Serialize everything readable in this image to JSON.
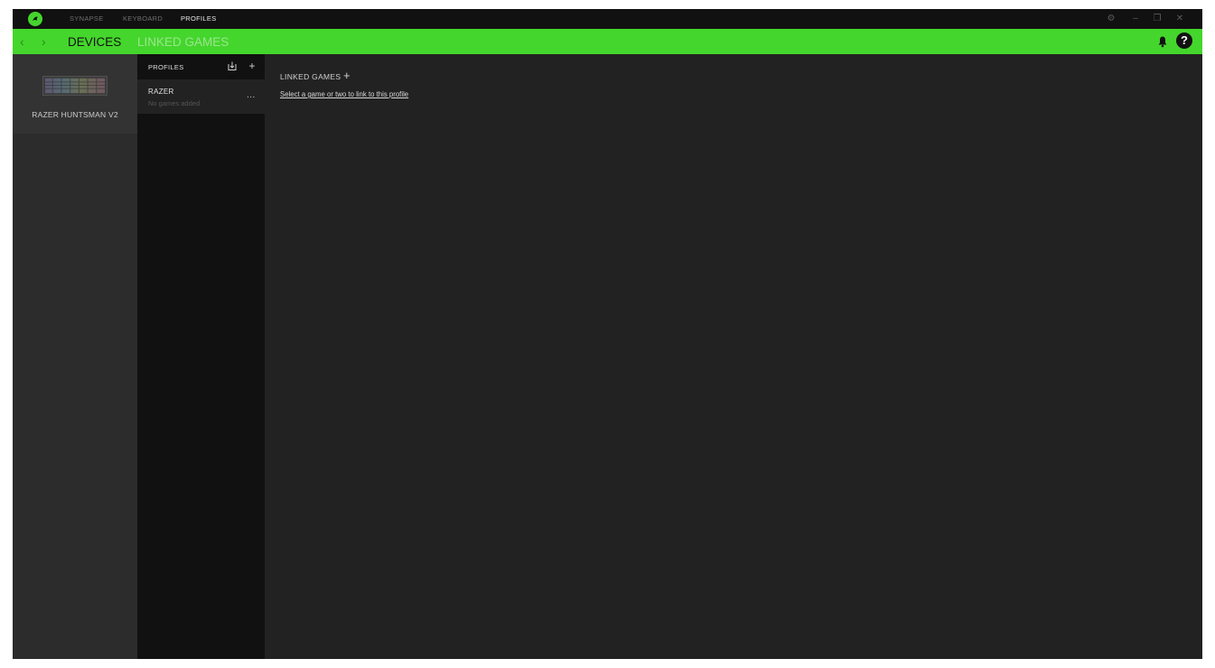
{
  "titlebar": {
    "nav": [
      "SYNAPSE",
      "KEYBOARD",
      "PROFILES"
    ],
    "active_nav": "PROFILES",
    "window_controls": [
      "settings-icon",
      "minimize-icon",
      "restore-icon",
      "close-icon"
    ]
  },
  "greenbar": {
    "tabs": [
      "DEVICES",
      "LINKED GAMES"
    ],
    "active_tab": "DEVICES",
    "help_label": "?"
  },
  "devices": {
    "items": [
      {
        "name": "RAZER HUNTSMAN V2"
      }
    ]
  },
  "profiles": {
    "header": "PROFILES",
    "items": [
      {
        "name": "RAZER",
        "subtitle": "No games added",
        "menu_label": "..."
      }
    ]
  },
  "linked_games": {
    "title": "LINKED GAMES",
    "add_label": "+",
    "prompt": "Select a game or two to link to this profile"
  },
  "colors": {
    "accent": "#44d62c",
    "background": "#222222",
    "titlebar": "#111111"
  }
}
